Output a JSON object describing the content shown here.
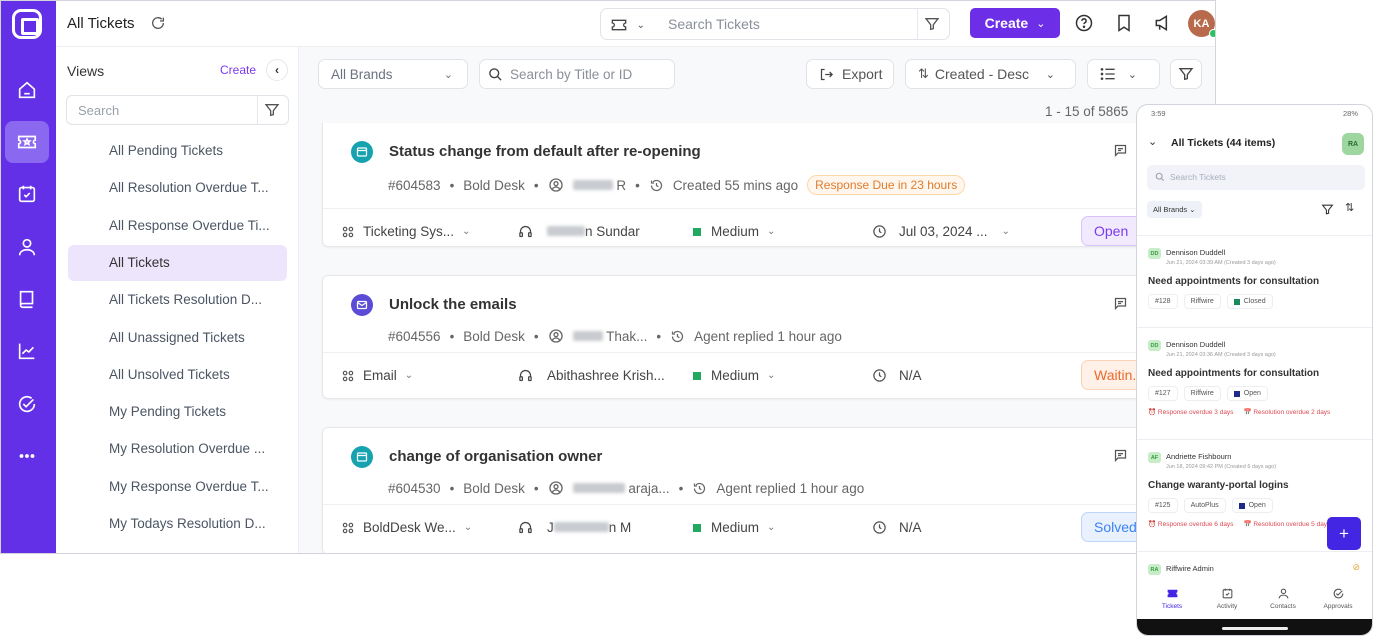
{
  "app": {
    "page_title": "All Tickets",
    "global_search_placeholder": "Search Tickets",
    "create_label": "Create",
    "user_initials": "KA"
  },
  "rail": {
    "items": [
      "home",
      "tickets",
      "activities",
      "contacts",
      "knowledge-base",
      "reports",
      "approvals",
      "more"
    ],
    "active": "tickets"
  },
  "views": {
    "title": "Views",
    "create_label": "Create",
    "search_placeholder": "Search",
    "items": [
      {
        "label": "All Pending Tickets"
      },
      {
        "label": "All Resolution Overdue T..."
      },
      {
        "label": "All Response Overdue Ti..."
      },
      {
        "label": "All Tickets",
        "active": true
      },
      {
        "label": "All Tickets Resolution D..."
      },
      {
        "label": "All Unassigned Tickets"
      },
      {
        "label": "All Unsolved Tickets"
      },
      {
        "label": "My Pending Tickets"
      },
      {
        "label": "My Resolution Overdue ..."
      },
      {
        "label": "My Response Overdue T..."
      },
      {
        "label": "My Todays Resolution D..."
      }
    ]
  },
  "toolbar": {
    "brand_select": "All Brands",
    "search_placeholder": "Search by Title or ID",
    "export_label": "Export",
    "sort_label": "Created - Desc",
    "pagination": "1 - 15 of 5865"
  },
  "tickets": [
    {
      "channel": "portal",
      "title": "Status change from default after re-opening",
      "id": "#604583",
      "brand": "Bold Desk",
      "requester_suffix": "R",
      "activity": "Created 55 mins ago",
      "sla_badge": "Response Due in 23 hours",
      "category": "Ticketing Sys...",
      "agent_suffix": "n Sundar",
      "priority": "Medium",
      "due": "Jul 03, 2024 ...",
      "status": "Open"
    },
    {
      "channel": "email",
      "title": "Unlock the emails",
      "id": "#604556",
      "brand": "Bold Desk",
      "requester_suffix": "Thak...",
      "activity": "Agent replied 1 hour ago",
      "category": "Email",
      "agent_suffix": "Abithashree Krish...",
      "priority": "Medium",
      "due": "N/A",
      "status": "Waitin..."
    },
    {
      "channel": "portal",
      "title": "change of organisation owner",
      "id": "#604530",
      "brand": "Bold Desk",
      "requester_suffix": "araja...",
      "activity": "Agent replied 1 hour ago",
      "category": "BoldDesk We...",
      "agent_prefix": "J",
      "agent_suffix": "n M",
      "priority": "Medium",
      "due": "N/A",
      "status": "Solved"
    }
  ],
  "colors": {
    "brand": "#6330e8",
    "priority_medium": "#22a861",
    "status_open": "#7c3aed",
    "status_waiting": "#ea6a2a",
    "status_solved": "#3b82f6"
  },
  "mobile": {
    "time": "3:59",
    "battery": "28%",
    "title": "All Tickets (44 items)",
    "user_initials": "RA",
    "search_placeholder": "Search Tickets",
    "brand_filter": "All Brands",
    "items": [
      {
        "initials": "DD",
        "name": "Dennison Duddell",
        "date": "Jun 21, 2024 03:39 AM (Created 3 days ago)",
        "subject": "Need appointments for consultation",
        "id": "#128",
        "brand": "Riffwire",
        "status": "Closed"
      },
      {
        "initials": "DD",
        "name": "Dennison Duddell",
        "date": "Jun 21, 2024 03:36 AM (Created 3 days ago)",
        "subject": "Need appointments for consultation",
        "id": "#127",
        "brand": "Riffwire",
        "status": "Open",
        "response_overdue": "Response overdue 3 days",
        "resolution_overdue": "Resolution overdue 2 days"
      },
      {
        "initials": "AF",
        "name": "Andriette Fishbourn",
        "date": "Jun 18, 2024 09:42 PM (Created 6 days ago)",
        "subject": "Change waranty-portal logins",
        "id": "#125",
        "brand": "AutoPlus",
        "status": "Open",
        "response_overdue": "Response overdue 6 days",
        "resolution_overdue": "Resolution overdue 5 days"
      },
      {
        "initials": "RA",
        "name": "Riffwire Admin"
      }
    ],
    "nav": [
      "Tickets",
      "Activity",
      "Contacts",
      "Approvals"
    ]
  }
}
